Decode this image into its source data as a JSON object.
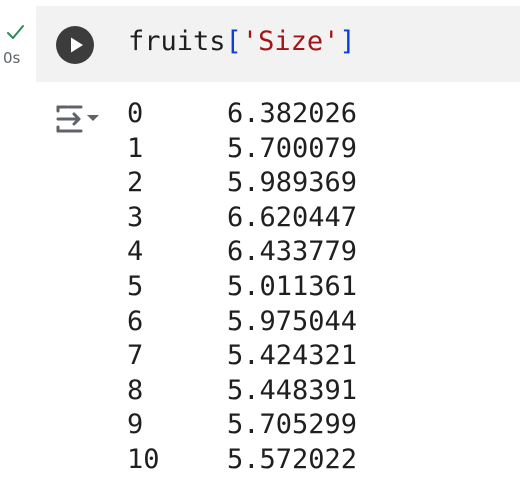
{
  "cell": {
    "status": "success",
    "exec_time": "0s",
    "code": {
      "identifier": "fruits",
      "open_bracket": "[",
      "string": "'Size'",
      "close_bracket": "]"
    }
  },
  "output": {
    "rows": [
      {
        "index": "0",
        "value": "6.382026"
      },
      {
        "index": "1",
        "value": "5.700079"
      },
      {
        "index": "2",
        "value": "5.989369"
      },
      {
        "index": "3",
        "value": "6.620447"
      },
      {
        "index": "4",
        "value": "6.433779"
      },
      {
        "index": "5",
        "value": "5.011361"
      },
      {
        "index": "6",
        "value": "5.975044"
      },
      {
        "index": "7",
        "value": "5.424321"
      },
      {
        "index": "8",
        "value": "5.448391"
      },
      {
        "index": "9",
        "value": "5.705299"
      },
      {
        "index": "10",
        "value": "5.572022"
      }
    ]
  },
  "colors": {
    "check": "#2e8b57",
    "cell_background": "#f2f2f2",
    "run_button": "#3c3c3c",
    "bracket": "#0b3fd1",
    "string": "#a31515",
    "icon": "#5f6368"
  },
  "icons": {
    "status": "check-icon",
    "run": "play-icon",
    "output_toggle": "output-toggle-icon"
  }
}
